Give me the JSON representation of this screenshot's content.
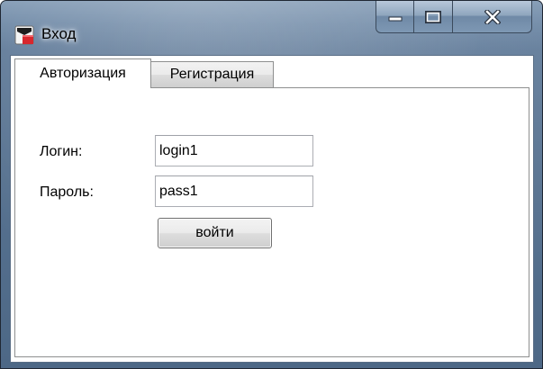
{
  "window": {
    "title": "Вход",
    "icon": "app-icon"
  },
  "caption_buttons": {
    "minimize_icon": "minimize-icon",
    "maximize_icon": "maximize-icon",
    "close_icon": "close-icon"
  },
  "tabs": [
    {
      "label": "Авторизация",
      "selected": true
    },
    {
      "label": "Регистрация",
      "selected": false
    }
  ],
  "form": {
    "login_label": "Логин:",
    "login_value": "login1",
    "password_label": "Пароль:",
    "password_value": "pass1",
    "submit_label": "войти"
  }
}
